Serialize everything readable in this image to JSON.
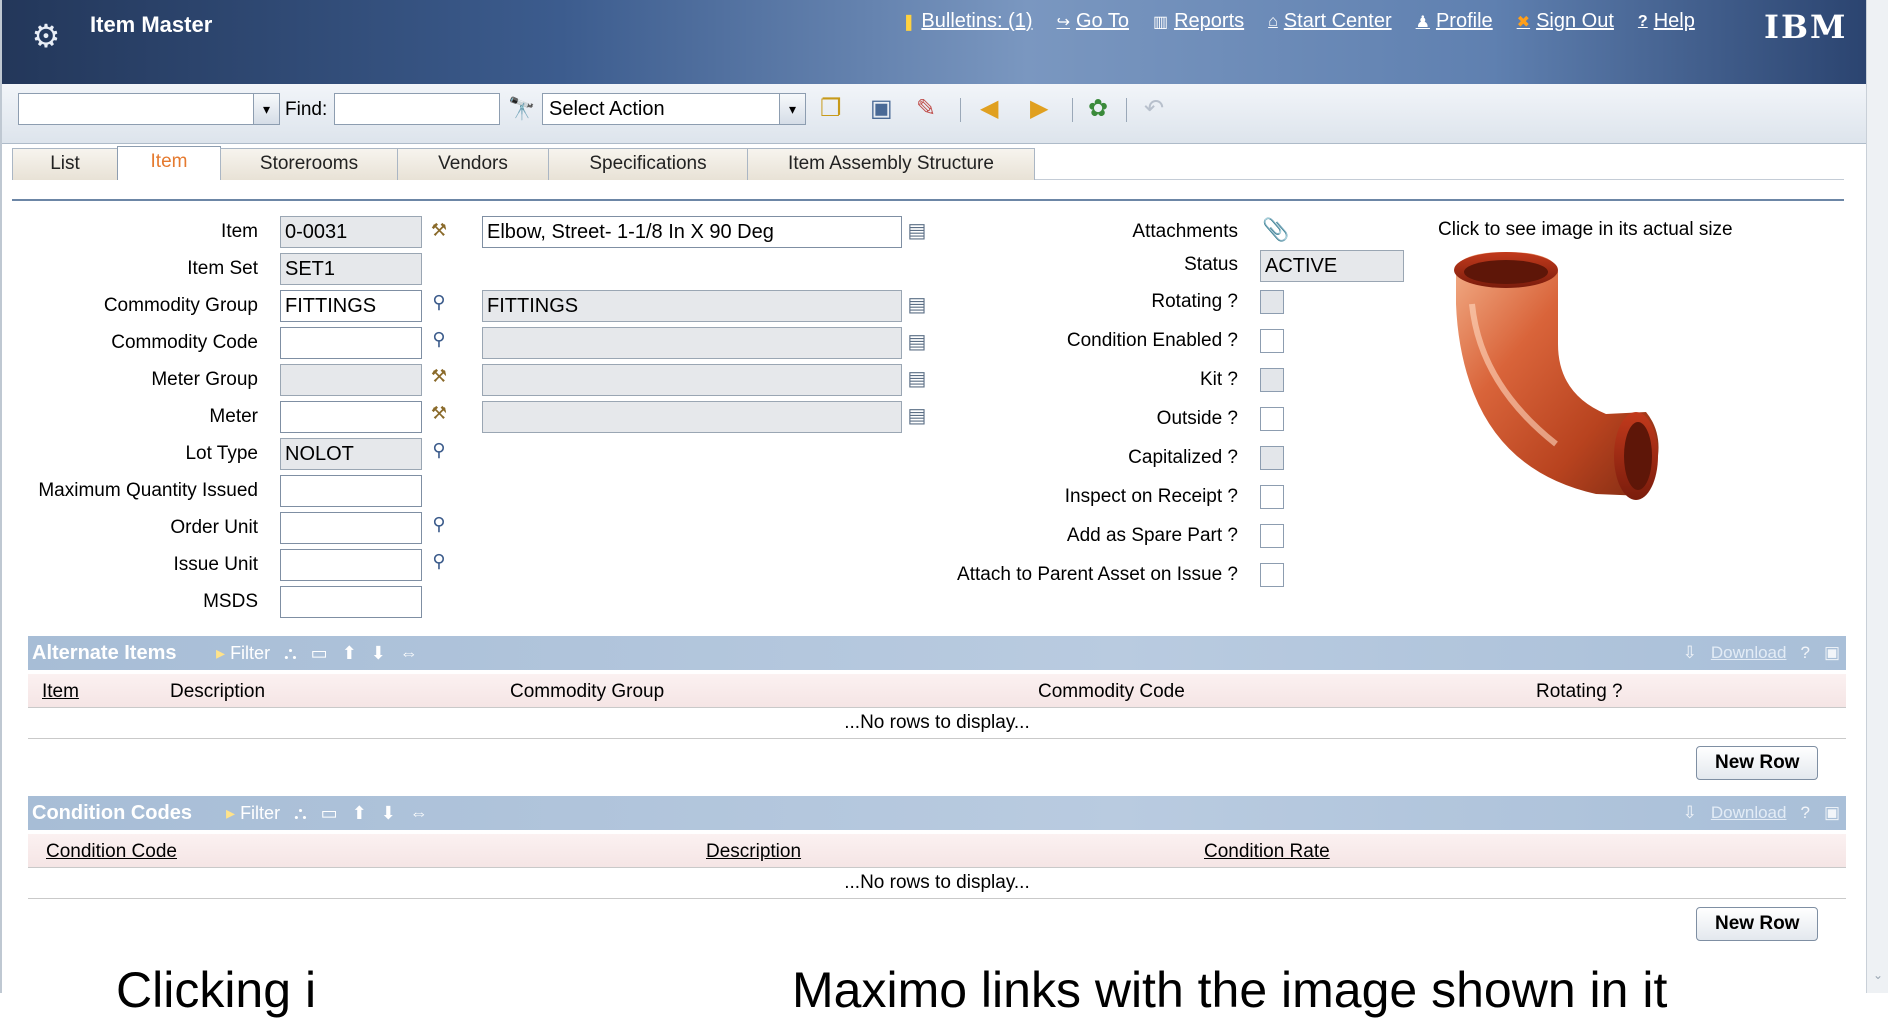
{
  "header": {
    "app_title": "Item Master",
    "nav": [
      {
        "label": "Bulletins: (1)",
        "icon": "bulletin-icon"
      },
      {
        "label": "Go To",
        "icon": "goto-arrow-icon"
      },
      {
        "label": "Reports",
        "icon": "reports-chart-icon"
      },
      {
        "label": "Start Center",
        "icon": "home-icon"
      },
      {
        "label": "Profile",
        "icon": "person-icon"
      },
      {
        "label": "Sign Out",
        "icon": "x-icon"
      },
      {
        "label": "Help",
        "icon": "question-icon"
      }
    ],
    "logo": "IBM"
  },
  "toolbar": {
    "find_label": "Find:",
    "find_value": "",
    "action_value": "Select Action"
  },
  "tabs": [
    "List",
    "Item",
    "Storerooms",
    "Vendors",
    "Specifications",
    "Item Assembly Structure"
  ],
  "form": {
    "item_label": "Item",
    "item_value": "0-0031",
    "item_desc": "Elbow, Street- 1-1/8 In X 90 Deg",
    "itemset_label": "Item Set",
    "itemset_value": "SET1",
    "commodity_group_label": "Commodity Group",
    "commodity_group_value": "FITTINGS",
    "commodity_group_desc": "FITTINGS",
    "commodity_code_label": "Commodity Code",
    "commodity_code_value": "",
    "commodity_code_desc": "",
    "meter_group_label": "Meter Group",
    "meter_group_value": "",
    "meter_group_desc": "",
    "meter_label": "Meter",
    "meter_value": "",
    "meter_desc": "",
    "lot_type_label": "Lot Type",
    "lot_type_value": "NOLOT",
    "max_qty_label": "Maximum Quantity Issued",
    "max_qty_value": "",
    "order_unit_label": "Order Unit",
    "order_unit_value": "",
    "issue_unit_label": "Issue Unit",
    "issue_unit_value": "",
    "msds_label": "MSDS",
    "msds_value": "",
    "attachments_label": "Attachments",
    "status_label": "Status",
    "status_value": "ACTIVE",
    "rotating_label": "Rotating ?",
    "condition_enabled_label": "Condition Enabled ?",
    "kit_label": "Kit ?",
    "outside_label": "Outside ?",
    "capitalized_label": "Capitalized ?",
    "inspect_label": "Inspect on Receipt ?",
    "spare_part_label": "Add as Spare Part ?",
    "attach_parent_label": "Attach to Parent Asset on Issue ?",
    "image_caption": "Click to see image in its actual size"
  },
  "alternate_items": {
    "title": "Alternate Items",
    "filter_label": "Filter",
    "download_label": "Download",
    "columns": [
      "Item",
      "Description",
      "Commodity Group",
      "Commodity Code",
      "Rotating ?"
    ],
    "no_rows": "...No rows to display...",
    "new_row_label": "New Row"
  },
  "condition_codes": {
    "title": "Condition Codes",
    "filter_label": "Filter",
    "download_label": "Download",
    "columns": [
      "Condition Code",
      "Description",
      "Condition Rate"
    ],
    "no_rows": "...No rows to display...",
    "new_row_label": "New Row"
  },
  "caption": {
    "left": "Clicking i",
    "right": "Maximo links with the image shown in it"
  },
  "colors": {
    "header_dark": "#23375a",
    "section_header": "#a7bdd6",
    "active_tab_text": "#e57a2f"
  }
}
